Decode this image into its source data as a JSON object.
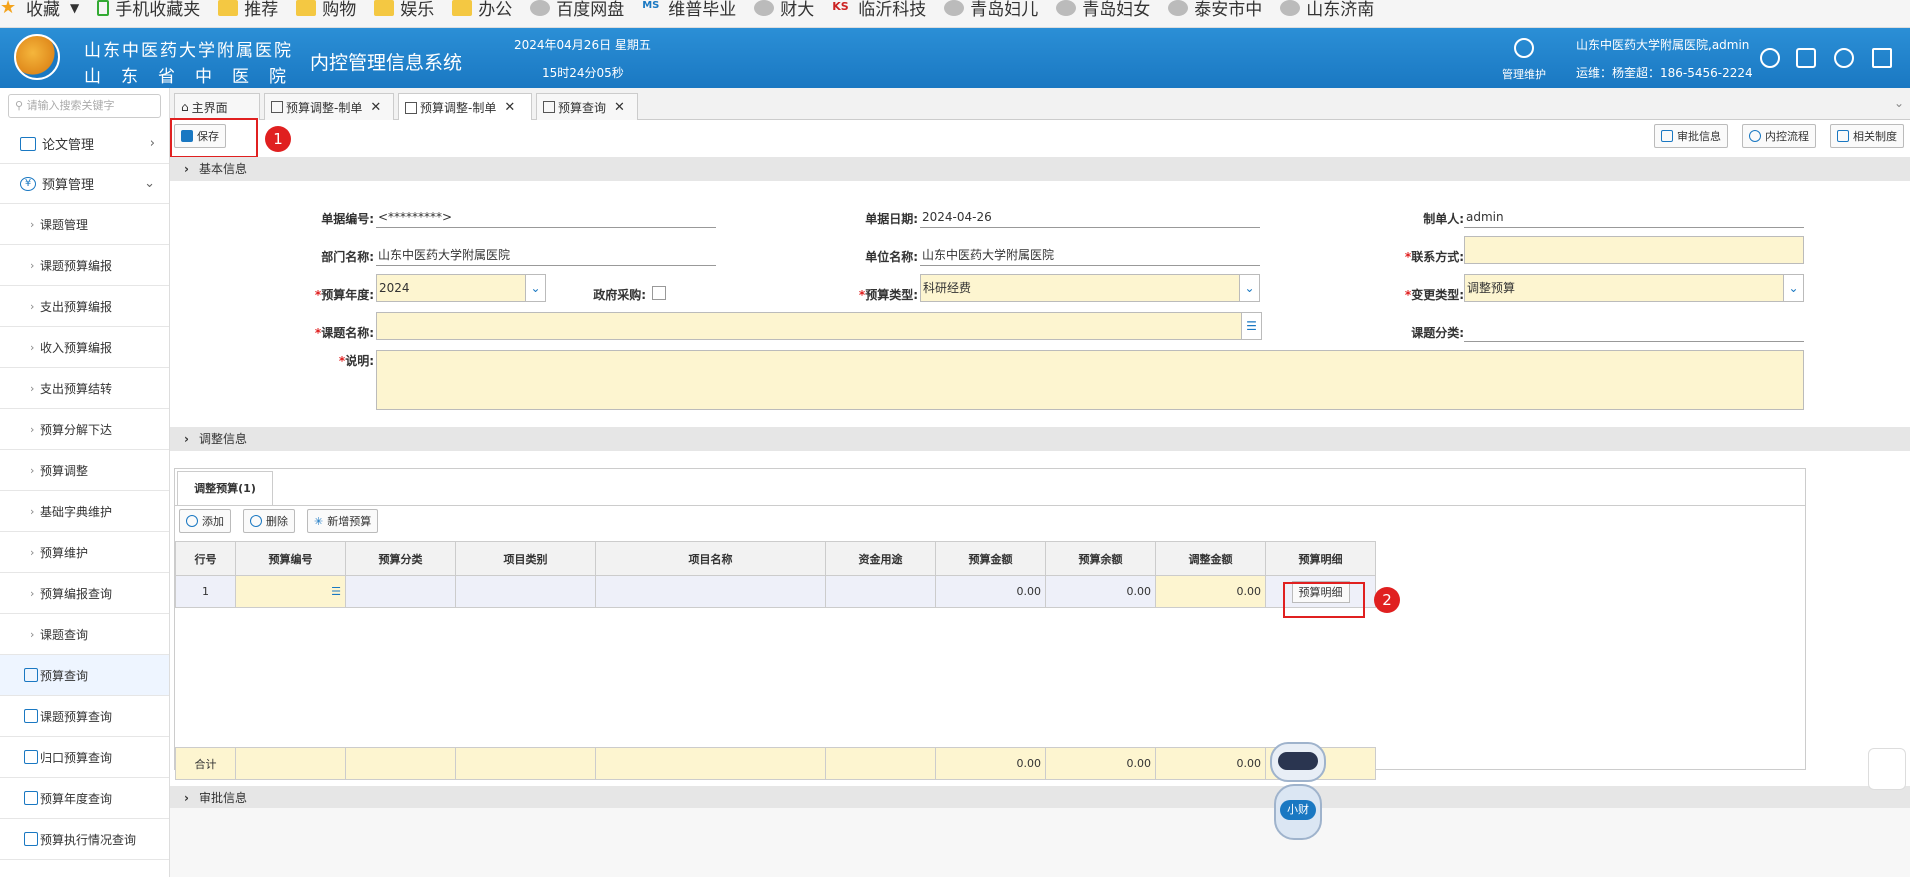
{
  "bookmarks": [
    {
      "label": "收藏",
      "icon": "star-icon"
    },
    {
      "label": "手机收藏夹",
      "icon": "phone-icon"
    },
    {
      "label": "推荐",
      "icon": "folder-icon"
    },
    {
      "label": "购物",
      "icon": "folder-icon"
    },
    {
      "label": "娱乐",
      "icon": "folder-icon"
    },
    {
      "label": "办公",
      "icon": "folder-icon"
    },
    {
      "label": "百度网盘",
      "icon": "globe-icon"
    },
    {
      "label": "维普毕业",
      "icon": "ms-icon"
    },
    {
      "label": "财大",
      "icon": "globe-icon"
    },
    {
      "label": "临沂科技",
      "icon": "ks-icon"
    },
    {
      "label": "青岛妇儿",
      "icon": "globe-icon"
    },
    {
      "label": "青岛妇女",
      "icon": "globe-icon"
    },
    {
      "label": "泰安市中",
      "icon": "globe-icon"
    },
    {
      "label": "山东济南",
      "icon": "globe-icon"
    }
  ],
  "header": {
    "org_line1": "山东中医药大学附属医院",
    "org_line2": "山东省中医院",
    "system": "内控管理信息系统",
    "date": "2024年04月26日 星期五",
    "time": "15时24分05秒",
    "mgmt_label": "管理维护",
    "user": "山东中医药大学附属医院,admin",
    "support": "运维：杨奎超：186-5456-2224"
  },
  "sidebar": {
    "search_placeholder": "请输入搜索关键字",
    "items": [
      {
        "label": "论文管理",
        "level": "top"
      },
      {
        "label": "预算管理",
        "level": "top"
      },
      {
        "label": "课题管理"
      },
      {
        "label": "课题预算编报"
      },
      {
        "label": "支出预算编报"
      },
      {
        "label": "收入预算编报"
      },
      {
        "label": "支出预算结转"
      },
      {
        "label": "预算分解下达"
      },
      {
        "label": "预算调整"
      },
      {
        "label": "基础字典维护"
      },
      {
        "label": "预算维护"
      },
      {
        "label": "预算编报查询"
      },
      {
        "label": "课题查询"
      },
      {
        "label": "预算查询",
        "active": true
      },
      {
        "label": "课题预算查询"
      },
      {
        "label": "归口预算查询"
      },
      {
        "label": "预算年度查询"
      },
      {
        "label": "预算执行情况查询"
      }
    ]
  },
  "tabs": [
    {
      "label": "主界面"
    },
    {
      "label": "预算调整-制单",
      "closable": true
    },
    {
      "label": "预算调整-制单",
      "closable": true,
      "active": true
    },
    {
      "label": "预算查询",
      "closable": true
    }
  ],
  "toolbar": {
    "save": "保存",
    "approval_info": "审批信息",
    "control_flow": "内控流程",
    "related_rules": "相关制度"
  },
  "annotations": {
    "one": "1",
    "two": "2"
  },
  "sections": {
    "basic": "基本信息",
    "adjust": "调整信息",
    "approval": "审批信息"
  },
  "form": {
    "doc_no_label": "单据编号:",
    "doc_no": "<*********>",
    "doc_date_label": "单据日期:",
    "doc_date": "2024-04-26",
    "maker_label": "制单人:",
    "maker": "admin",
    "dept_label": "部门名称:",
    "dept": "山东中医药大学附属医院",
    "unit_label": "单位名称:",
    "unit": "山东中医药大学附属医院",
    "contact_label": "联系方式:",
    "contact": "",
    "year_label": "预算年度:",
    "year": "2024",
    "gov_label": "政府采购:",
    "btype_label": "预算类型:",
    "btype": "科研经费",
    "ctype_label": "变更类型:",
    "ctype": "调整预算",
    "topic_label": "课题名称:",
    "topic": "",
    "topic_class_label": "课题分类:",
    "topic_class": "",
    "desc_label": "说明:",
    "desc": ""
  },
  "grid": {
    "tab": "调整预算(1)",
    "add": "添加",
    "delete": "删除",
    "new_budget": "新增预算",
    "columns": [
      "行号",
      "预算编号",
      "预算分类",
      "项目类别",
      "项目名称",
      "资金用途",
      "预算金额",
      "预算余额",
      "调整金额",
      "预算明细"
    ],
    "row": {
      "no": "1",
      "budget_amt": "0.00",
      "balance": "0.00",
      "adjust_amt": "0.00",
      "detail_btn": "预算明细"
    },
    "sum": {
      "label": "合计",
      "budget_amt": "0.00",
      "balance": "0.00",
      "adjust_amt": "0.00"
    }
  },
  "robot_label": "小财"
}
